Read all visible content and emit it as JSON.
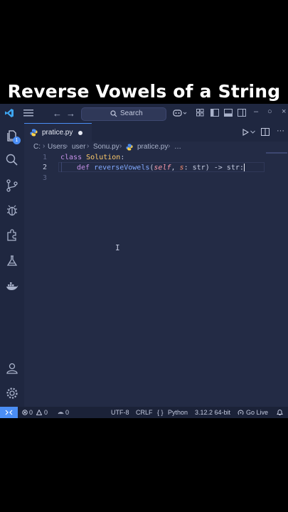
{
  "caption": "Reverse Vowels of a String",
  "titlebar": {
    "search_label": "Search"
  },
  "activity": {
    "explorer_badge": "1"
  },
  "tab": {
    "label": "pratice.py"
  },
  "breadcrumb": {
    "items": [
      "C:",
      "Users",
      "user",
      "Sonu.py",
      "pratice.py",
      "…"
    ]
  },
  "editor": {
    "line_numbers": [
      "1",
      "2",
      "3"
    ],
    "line1": {
      "kw": "class",
      "name": "Solution",
      "colon": ":"
    },
    "line2": {
      "kw": "def",
      "fn": "reverseVowels",
      "open": "(",
      "self": "self",
      "comma": ", ",
      "param": "s",
      "colon": ": ",
      "type1": "str",
      "close": ") -> ",
      "type2": "str",
      "end": ":"
    },
    "ibeam": "I"
  },
  "statusbar": {
    "remote_icon": "remote-icon",
    "errors": "0",
    "warnings": "0",
    "ports": "0",
    "encoding": "UTF-8",
    "eol": "CRLF",
    "language_prefix": "{ }",
    "language": "Python",
    "interpreter": "3.12.2 64-bit",
    "go_live": "Go Live"
  },
  "colors": {
    "accent": "#4b8ef5",
    "editor_bg": "#232b45",
    "chrome_bg": "#1f2740"
  }
}
